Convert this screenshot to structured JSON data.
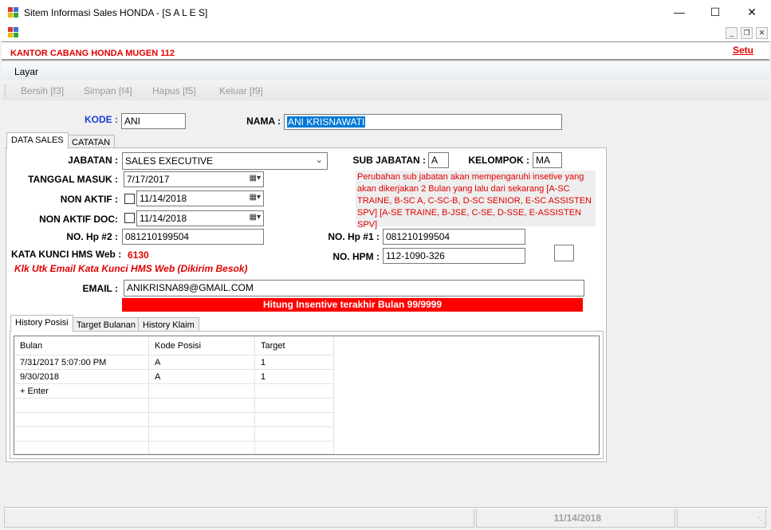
{
  "window": {
    "title": "Sitem Informasi Sales HONDA - [S A L E S]"
  },
  "header": {
    "office": "KANTOR CABANG HONDA MUGEN 112",
    "link": "Setu"
  },
  "menu": {
    "layar": "Layar"
  },
  "toolbar": {
    "bersih": "Bersih [f3]",
    "simpan": "Simpan [f4]",
    "hapus": "Hapus [f5]",
    "keluar": "Keluar [f9]"
  },
  "form": {
    "kode_label": "KODE :",
    "kode_value": "ANI",
    "nama_label": "NAMA :",
    "nama_value": "ANI KRISNAWATI",
    "tabs": [
      "DATA SALES",
      "CATATAN"
    ],
    "jabatan_label": "JABATAN :",
    "jabatan_value": "SALES EXECUTIVE",
    "sub_jabatan_label": "SUB JABATAN :",
    "sub_jabatan_value": "A",
    "kelompok_label": "KELOMPOK :",
    "kelompok_value": "MA",
    "tanggal_masuk_label": "TANGGAL MASUK :",
    "tanggal_masuk_value": "7/17/2017",
    "non_aktif_label": "NON AKTIF :",
    "non_aktif_value": "11/14/2018",
    "non_aktif_doc_label": "NON AKTIF DOC:",
    "non_aktif_doc_value": "11/14/2018",
    "note": "Perubahan sub jabatan akan mempengaruhi insetive yang akan dikerjakan 2 Bulan yang lalu dari sekarang   [A-SC TRAINE, B-SC A, C-SC-B, D-SC SENIOR, E-SC ASSISTEN SPV]   [A-SE TRAINE, B-JSE, C-SE, D-SSE, E-ASSISTEN SPV]",
    "hp2_label": "NO. Hp #2 :",
    "hp2_value": "081210199504",
    "hp1_label": "NO. Hp #1 :",
    "hp1_value": "081210199504",
    "hpm_label": "NO. HPM :",
    "hpm_value": "112-1090-326",
    "kata_kunci_label": "KATA KUNCI HMS Web :",
    "kata_kunci_value": "6130",
    "email_link": "Klk Utk Email Kata Kunci HMS Web (Dikirim Besok)",
    "email_label": "EMAIL :",
    "email_value": "ANIKRISNA89@GMAIL.COM",
    "insentive_bar": "Hitung Insentive terakhir Bulan 99/9999"
  },
  "history": {
    "tabs": [
      "History Posisi",
      "Target Bulanan",
      "History Klaim"
    ],
    "columns": [
      "Bulan",
      "Kode Posisi",
      "Target"
    ],
    "rows": [
      [
        "7/31/2017 5:07:00 PM",
        "A",
        "1"
      ],
      [
        "9/30/2018",
        "A",
        "1"
      ],
      [
        "+ Enter",
        "",
        ""
      ]
    ]
  },
  "status": {
    "date": "11/14/2018"
  },
  "colors": {
    "accent_red": "#e00000",
    "selection_blue": "#0078d7"
  }
}
